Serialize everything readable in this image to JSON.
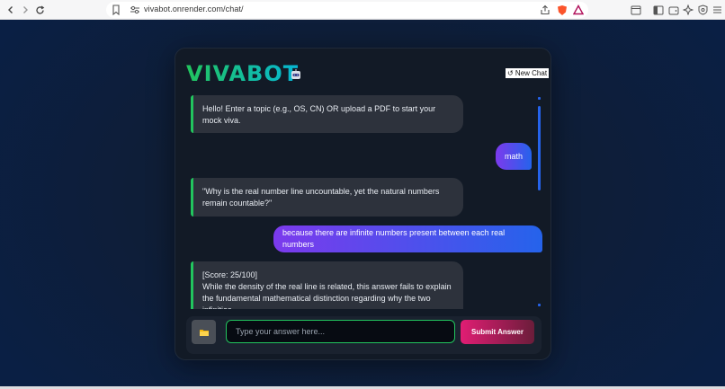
{
  "browser": {
    "url": "vivabot.onrender.com/chat/"
  },
  "app": {
    "title": "VIVABOT",
    "new_chat_label": "↺ New Chat"
  },
  "messages": [
    {
      "role": "bot",
      "text": "Hello! Enter a topic (e.g., OS, CN) OR upload a PDF to start your mock viva."
    },
    {
      "role": "user",
      "text": "math"
    },
    {
      "role": "bot",
      "text": "\"Why is the real number line uncountable, yet the natural numbers remain countable?\""
    },
    {
      "role": "user",
      "text": "because there are infinite numbers present between each real numbers"
    },
    {
      "role": "bot",
      "text_line1": "[Score: 25/100]",
      "text_line2": "While the density of the real line is related, this answer fails to explain the fundamental mathematical distinction regarding why the two infinities"
    }
  ],
  "composer": {
    "placeholder": "Type your answer here...",
    "value": "",
    "submit_label": "Submit Answer"
  },
  "colors": {
    "accent_green": "#22c55e",
    "accent_blue": "#2563eb",
    "accent_purple": "#7c3aed",
    "accent_pink": "#e11d74",
    "background": "#0f1e36",
    "card": "#121a26"
  },
  "icons": {
    "logo": "robot-icon",
    "upload": "folder-icon"
  }
}
